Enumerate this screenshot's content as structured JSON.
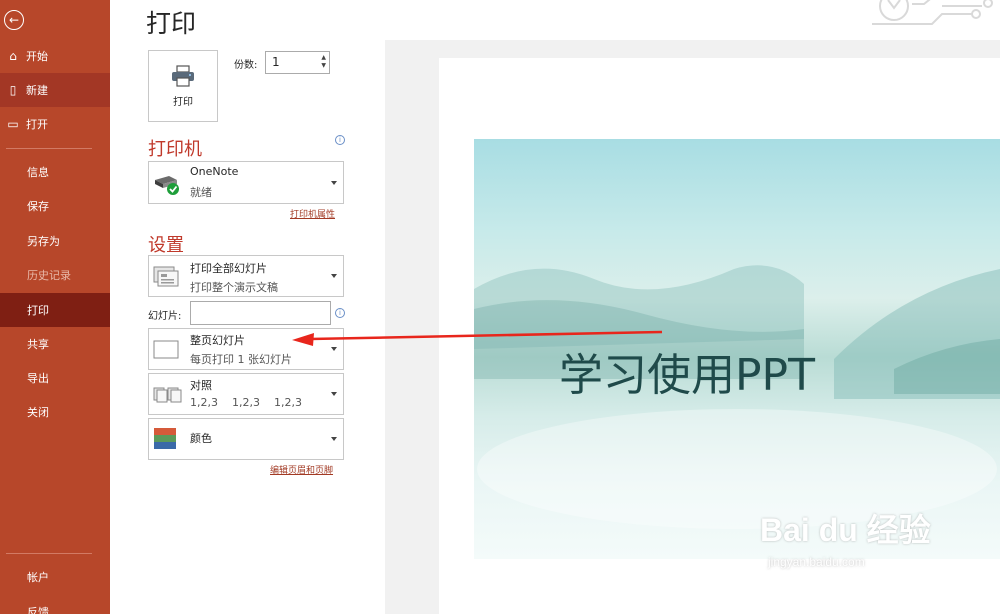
{
  "sidebar": {
    "back_label": "←",
    "items": [
      {
        "label": "开始",
        "icon": "home-icon",
        "glyph": "⌂"
      },
      {
        "label": "新建",
        "icon": "new-document-icon",
        "glyph": "▯"
      },
      {
        "label": "打开",
        "icon": "open-folder-icon",
        "glyph": "▭"
      },
      {
        "label": "信息"
      },
      {
        "label": "保存"
      },
      {
        "label": "另存为"
      },
      {
        "label": "历史记录"
      },
      {
        "label": "打印"
      },
      {
        "label": "共享"
      },
      {
        "label": "导出"
      },
      {
        "label": "关闭"
      },
      {
        "label": "帐户"
      },
      {
        "label": "反馈"
      }
    ],
    "color": "#b7472a"
  },
  "page": {
    "title": "打印"
  },
  "print_button": {
    "label": "打印"
  },
  "copies": {
    "label": "份数:",
    "value": "1"
  },
  "printer": {
    "section_title": "打印机",
    "name": "OneNote",
    "status": "就绪",
    "properties_link": "打印机属性"
  },
  "settings": {
    "section_title": "设置",
    "range": {
      "title": "打印全部幻灯片",
      "subtitle": "打印整个演示文稿"
    },
    "slides_label": "幻灯片:",
    "slides_value": "",
    "layout": {
      "title": "整页幻灯片",
      "subtitle": "每页打印 1 张幻灯片"
    },
    "collate": {
      "title": "对照",
      "subtitle": "1,2,3    1,2,3    1,2,3"
    },
    "color": {
      "title": "颜色"
    },
    "header_footer_link": "编辑页眉和页脚"
  },
  "preview": {
    "slide_title": "学习使用PPT"
  },
  "watermark": {
    "main": "Bai du 经验",
    "sub": "jingyan.baidu.com"
  },
  "colors": {
    "accent": "#c0392b",
    "annotation_arrow": "#e8261c"
  }
}
